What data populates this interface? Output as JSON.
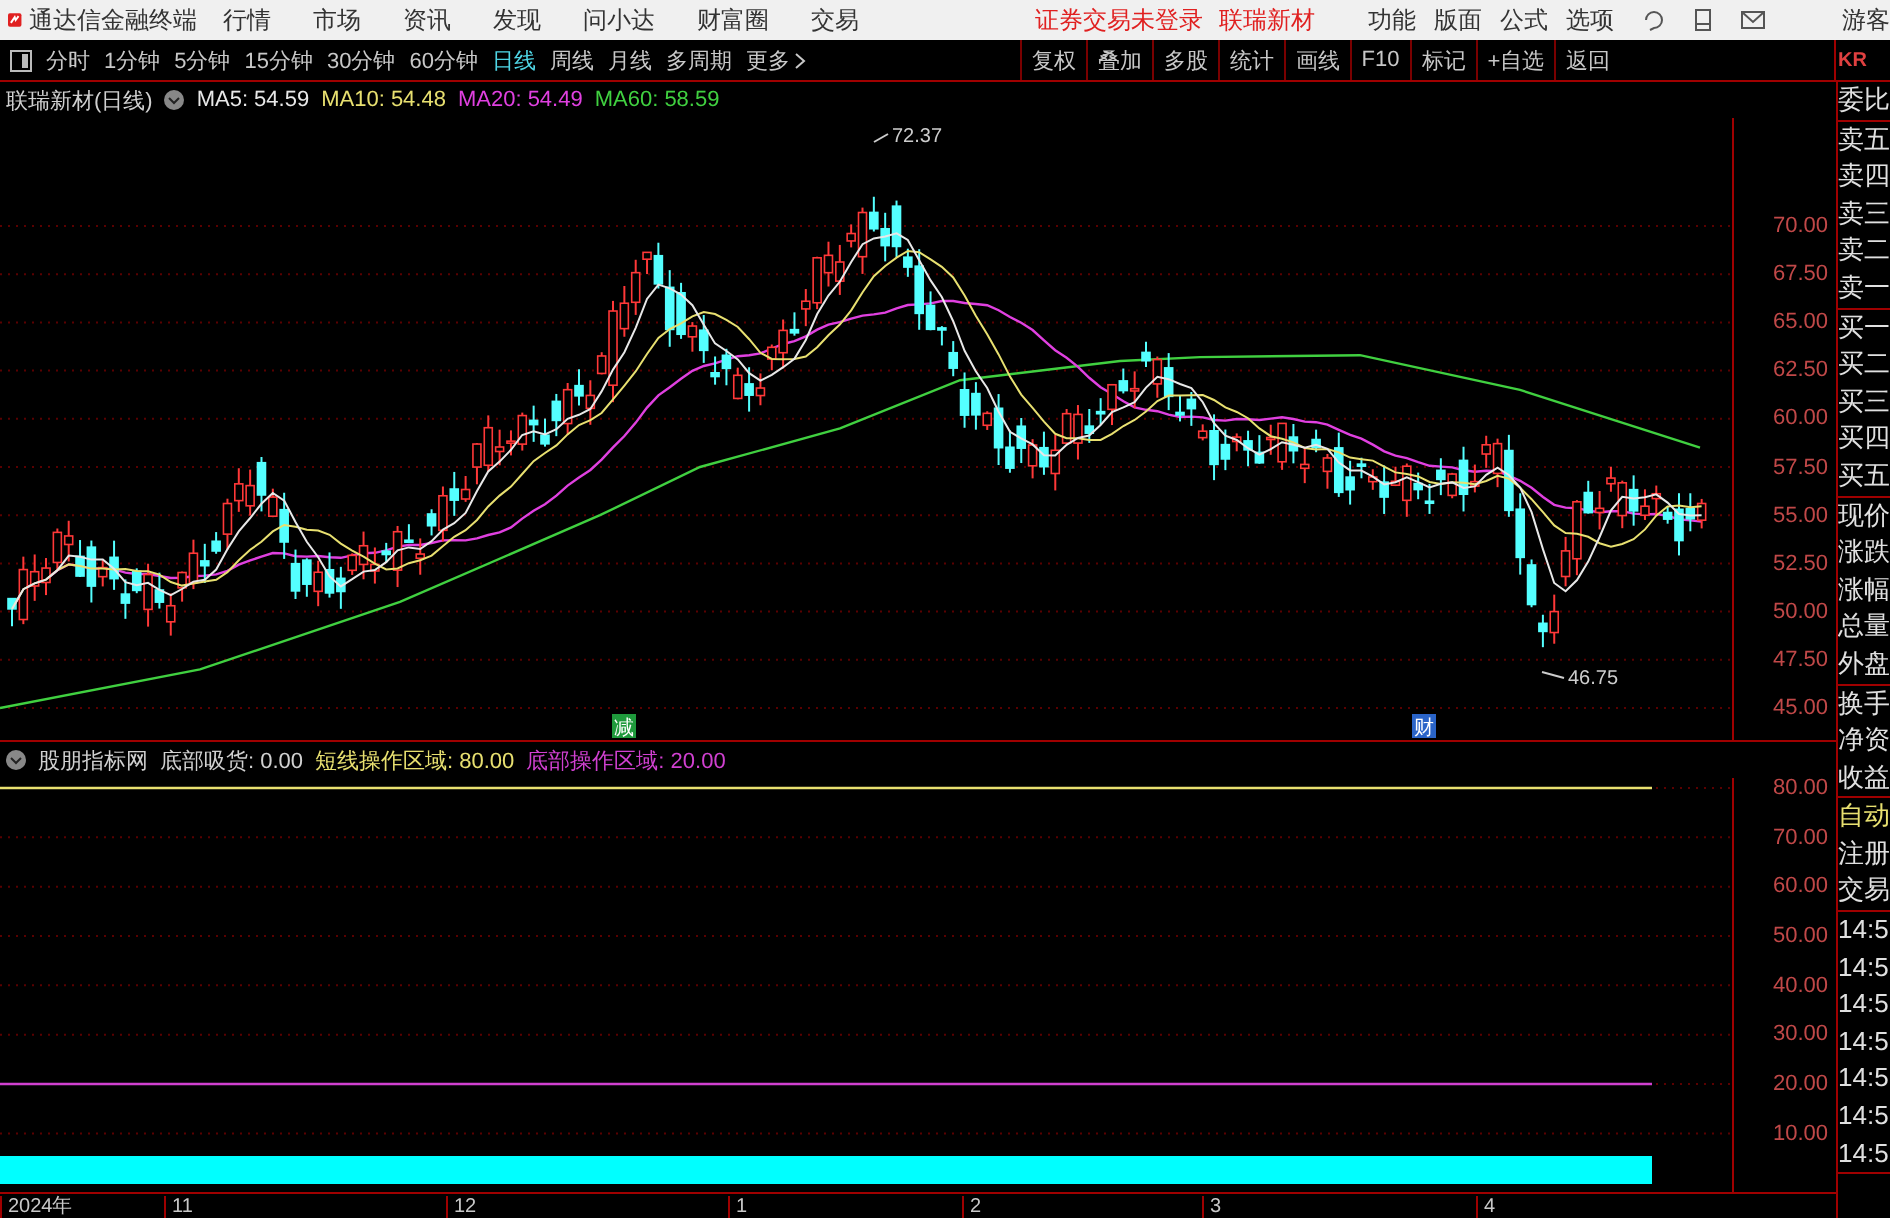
{
  "app": {
    "title": "通达信金融终端",
    "menus": [
      "行情",
      "市场",
      "资讯",
      "发现",
      "问小达",
      "财富圈",
      "交易"
    ],
    "status": "证券交易未登录",
    "stock": "联瑞新材",
    "tools": [
      "功能",
      "版面",
      "公式",
      "选项"
    ],
    "user": "游客"
  },
  "periods": [
    {
      "label": "分时",
      "selected": false
    },
    {
      "label": "1分钟",
      "selected": false
    },
    {
      "label": "5分钟",
      "selected": false
    },
    {
      "label": "15分钟",
      "selected": false
    },
    {
      "label": "30分钟",
      "selected": false
    },
    {
      "label": "60分钟",
      "selected": false
    },
    {
      "label": "日线",
      "selected": true
    },
    {
      "label": "周线",
      "selected": false
    },
    {
      "label": "月线",
      "selected": false
    },
    {
      "label": "多周期",
      "selected": false
    },
    {
      "label": "更多",
      "selected": false
    }
  ],
  "actions": [
    "复权",
    "叠加",
    "多股",
    "统计",
    "画线",
    "F10",
    "标记",
    "+自选",
    "返回"
  ],
  "main_chart": {
    "title": "联瑞新材(日线)",
    "indicators": [
      {
        "label": "MA5: 54.59",
        "color": "#e8e8e8"
      },
      {
        "label": "MA10: 54.48",
        "color": "#e8e070"
      },
      {
        "label": "MA20: 54.49",
        "color": "#e040e0"
      },
      {
        "label": "MA60: 58.59",
        "color": "#40d040"
      }
    ],
    "yticks": [
      "70.00",
      "67.50",
      "65.00",
      "62.50",
      "60.00",
      "57.50",
      "55.00",
      "52.50",
      "50.00",
      "47.50",
      "45.00"
    ],
    "annotations": [
      "72.37",
      "46.75"
    ],
    "events": [
      {
        "label": "减",
        "color": "#1f9a3c"
      },
      {
        "label": "财",
        "color": "#2a64c8"
      }
    ]
  },
  "indicator_chart": {
    "title": "股朋指标网",
    "indicators": [
      {
        "label": "底部吸货: 0.00",
        "color": "#d0d0d0"
      },
      {
        "label": "短线操作区域: 80.00",
        "color": "#e8e070"
      },
      {
        "label": "底部操作区域: 20.00",
        "color": "#d040d0"
      }
    ],
    "yticks": [
      "80.00",
      "70.00",
      "60.00",
      "50.00",
      "40.00",
      "30.00",
      "20.00",
      "10.00"
    ]
  },
  "date_axis": [
    "2024年",
    "11",
    "12",
    "1",
    "2",
    "3",
    "4"
  ],
  "side_panel": {
    "code": "KR",
    "groups": [
      [
        "委比"
      ],
      [
        "卖五",
        "卖四",
        "卖三",
        "卖二",
        "卖一"
      ],
      [
        "买一",
        "买二",
        "买三",
        "买四",
        "买五"
      ],
      [
        "现价",
        "涨跌",
        "涨幅",
        "总量",
        "外盘"
      ],
      [
        "换手",
        "净资",
        "收益"
      ],
      [
        {
          "text": "自动",
          "highlighted": true
        },
        {
          "text": "注册",
          "highlighted": false
        },
        {
          "text": "交易",
          "highlighted": false
        }
      ],
      [
        "14:5",
        "14:5",
        "14:5",
        "14:5",
        "14:5",
        "14:5",
        "14:5"
      ]
    ]
  }
}
